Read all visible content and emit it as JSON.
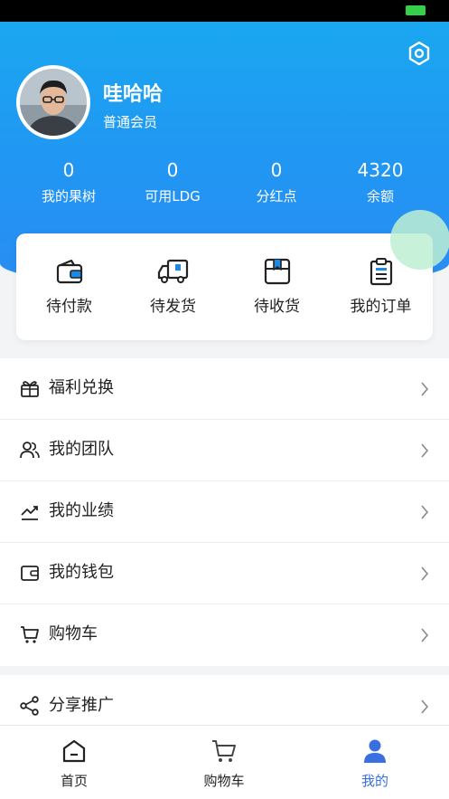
{
  "profile": {
    "name": "哇哈哈",
    "level": "普通会员"
  },
  "stats": [
    {
      "value": "0",
      "label": "我的果树"
    },
    {
      "value": "0",
      "label": "可用LDG"
    },
    {
      "value": "0",
      "label": "分红点"
    },
    {
      "value": "4320",
      "label": "余额"
    }
  ],
  "orders": [
    {
      "label": "待付款",
      "icon": "wallet-icon"
    },
    {
      "label": "待发货",
      "icon": "truck-icon"
    },
    {
      "label": "待收货",
      "icon": "box-icon"
    },
    {
      "label": "我的订单",
      "icon": "clipboard-icon"
    }
  ],
  "menu": [
    {
      "label": "福利兑换",
      "icon": "gift-icon"
    },
    {
      "label": "我的团队",
      "icon": "team-icon"
    },
    {
      "label": "我的业绩",
      "icon": "trend-icon"
    },
    {
      "label": "我的钱包",
      "icon": "wallet-icon"
    },
    {
      "label": "购物车",
      "icon": "cart-icon"
    }
  ],
  "menu2": [
    {
      "label": "分享推广",
      "icon": "share-icon"
    }
  ],
  "tabs": [
    {
      "label": "首页",
      "icon": "home-icon"
    },
    {
      "label": "购物车",
      "icon": "cart-icon"
    },
    {
      "label": "我的",
      "icon": "user-icon"
    }
  ],
  "colors": {
    "header": "#2196f3",
    "tab_active": "#3a6fe0",
    "fab": "#beeed2"
  }
}
